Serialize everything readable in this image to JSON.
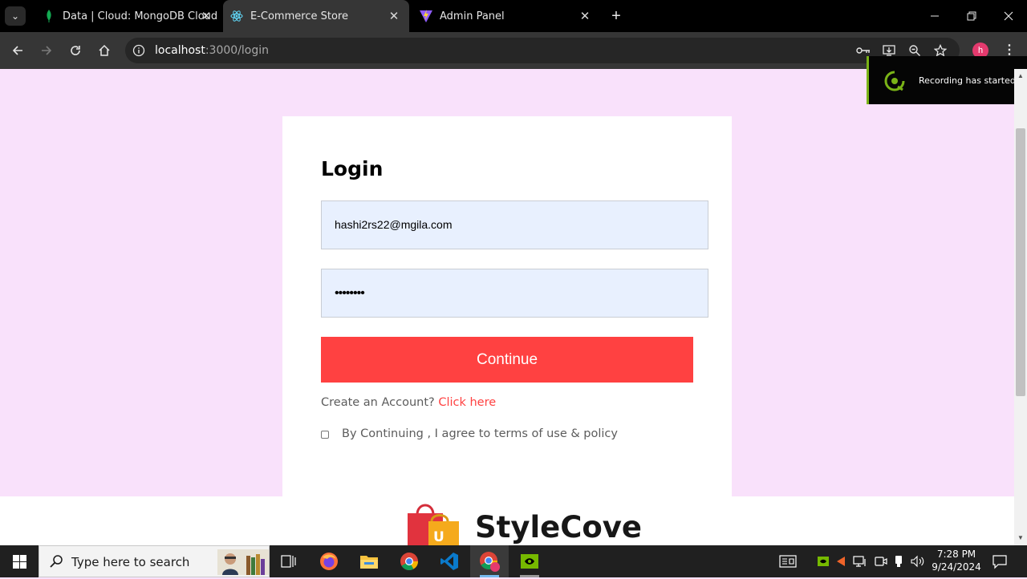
{
  "browser": {
    "tabs": [
      {
        "title": "Data | Cloud: MongoDB Cloud",
        "active": false
      },
      {
        "title": "E-Commerce Store",
        "active": true
      },
      {
        "title": "Admin Panel",
        "active": false
      }
    ],
    "url_host": "localhost",
    "url_path": ":3000/login",
    "profile_initial": "h"
  },
  "toast": {
    "text": "Recording has started"
  },
  "login": {
    "title": "Login",
    "email_value": "hashi2rs22@mgila.com",
    "password_value": "••••••••",
    "continue_label": "Continue",
    "create_prompt": "Create an Account?",
    "create_link": "Click here",
    "agree_text": "By Continuing , I agree to terms of use & policy",
    "agree_checked": false
  },
  "footer": {
    "brand": "StyleCove",
    "bag_letter": "U"
  },
  "taskbar": {
    "search_placeholder": "Type here to search",
    "time": "7:28 PM",
    "date": "9/24/2024"
  },
  "colors": {
    "page_bg": "#f9e1fb",
    "accent": "#ff4141",
    "field_bg": "#e8f0fe",
    "toast_border": "#7ab317"
  }
}
